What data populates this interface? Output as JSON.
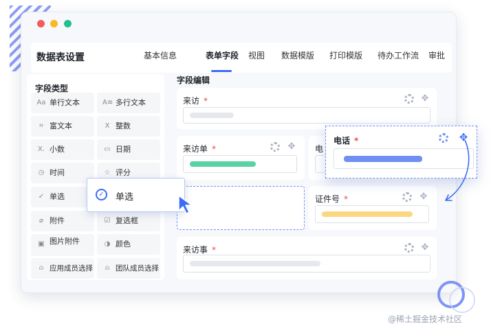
{
  "app": {
    "title": "数据表设置"
  },
  "tabs": [
    {
      "label": "基本信息",
      "active": false
    },
    {
      "label": "表单字段",
      "active": true
    },
    {
      "label": "视图",
      "active": false
    },
    {
      "label": "数据模版",
      "active": false
    },
    {
      "label": "打印模版",
      "active": false
    },
    {
      "label": "待办工作流",
      "active": false
    },
    {
      "label": "审批",
      "active": false
    }
  ],
  "field_types": {
    "title": "字段类型",
    "items": [
      {
        "label": "单行文本",
        "icon": "single-line-text-icon",
        "glyph": "Aa"
      },
      {
        "label": "多行文本",
        "icon": "multi-line-text-icon",
        "glyph": "A≡"
      },
      {
        "label": "富文本",
        "icon": "rich-text-icon",
        "glyph": "⌗"
      },
      {
        "label": "整数",
        "icon": "integer-icon",
        "glyph": "X"
      },
      {
        "label": "小数",
        "icon": "decimal-icon",
        "glyph": "X."
      },
      {
        "label": "日期",
        "icon": "calendar-icon",
        "glyph": "▭"
      },
      {
        "label": "时间",
        "icon": "clock-icon",
        "glyph": "◷"
      },
      {
        "label": "评分",
        "icon": "star-icon",
        "glyph": "☆"
      },
      {
        "label": "单选",
        "icon": "radio-icon",
        "glyph": "✓"
      },
      {
        "label": "",
        "icon": "",
        "glyph": ""
      },
      {
        "label": "附件",
        "icon": "paperclip-icon",
        "glyph": "⌀"
      },
      {
        "label": "复选框",
        "icon": "checkbox-icon",
        "glyph": "☑"
      },
      {
        "label": "图片附件",
        "icon": "image-icon",
        "glyph": "▣"
      },
      {
        "label": "颜色",
        "icon": "palette-icon",
        "glyph": "◑"
      },
      {
        "label": "应用成员选择",
        "icon": "user-icon",
        "glyph": "⍝"
      },
      {
        "label": "团队成员选择",
        "icon": "team-icon",
        "glyph": "⍝"
      }
    ]
  },
  "editor": {
    "title": "字段编辑",
    "fields": [
      {
        "label": "来访",
        "required": "*",
        "bar_color": "#e6e8ec"
      },
      {
        "label": "来访单",
        "required": "*",
        "bar_color": "#5cd1a4"
      },
      {
        "label": "电",
        "required": ""
      },
      {
        "label": "证件号",
        "required": "*",
        "bar_color": "#fbd784"
      },
      {
        "label": "来访事",
        "required": "*",
        "bar_color": "#e6e8ec"
      }
    ]
  },
  "drag_item": {
    "label": "单选"
  },
  "floating_field": {
    "label": "电话",
    "required": "*",
    "bar_color": "#6f8ff2"
  },
  "watermark": "@稀土掘金技术社区",
  "colors": {
    "accent": "#3b6cf6",
    "required": "#e84b3c",
    "window_bg": "#f7f8fb"
  }
}
